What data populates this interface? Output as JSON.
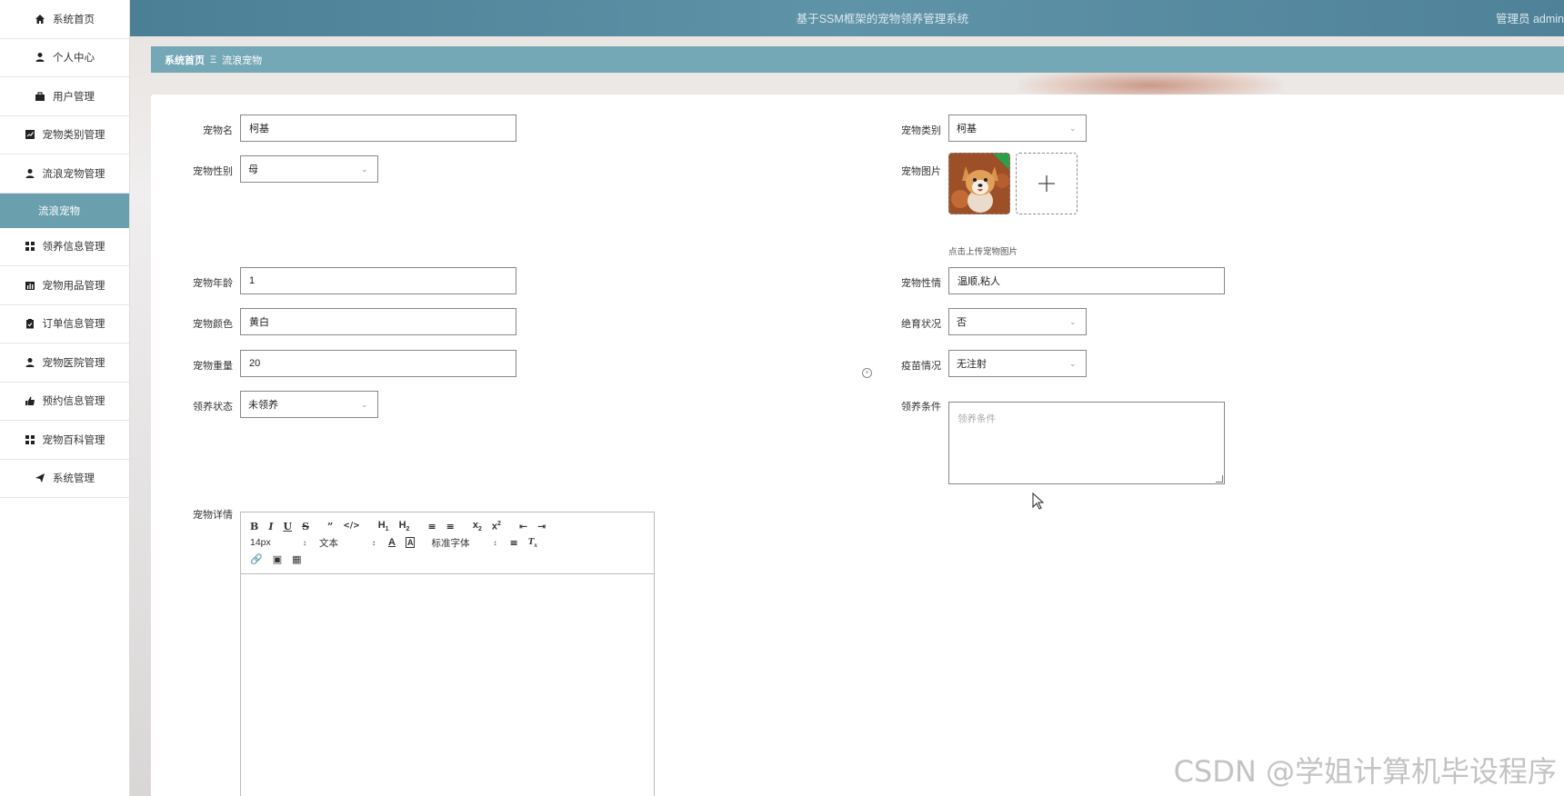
{
  "app": {
    "title": "基于SSM框架的宠物领养管理系统",
    "user": "管理员 admin"
  },
  "sidebar": {
    "items": [
      {
        "label": "系统首页",
        "icon": "home-icon"
      },
      {
        "label": "个人中心",
        "icon": "user-icon"
      },
      {
        "label": "用户管理",
        "icon": "briefcase-icon"
      },
      {
        "label": "宠物类别管理",
        "icon": "chart-icon"
      },
      {
        "label": "流浪宠物管理",
        "icon": "user-icon"
      },
      {
        "label": "流浪宠物",
        "icon": "",
        "active": true
      },
      {
        "label": "领养信息管理",
        "icon": "grid-icon"
      },
      {
        "label": "宠物用品管理",
        "icon": "bar-chart-icon"
      },
      {
        "label": "订单信息管理",
        "icon": "clipboard-icon"
      },
      {
        "label": "宠物医院管理",
        "icon": "user-icon"
      },
      {
        "label": "预约信息管理",
        "icon": "thumb-icon"
      },
      {
        "label": "宠物百科管理",
        "icon": "grid-icon"
      },
      {
        "label": "系统管理",
        "icon": "send-icon"
      }
    ],
    "active_color": "#6a9fae"
  },
  "breadcrumb": {
    "home": "系统首页",
    "separator": "Ξ",
    "current": "流浪宠物"
  },
  "form": {
    "pet_name": {
      "label": "宠物名",
      "value": "柯基"
    },
    "pet_category": {
      "label": "宠物类别",
      "value": "柯基"
    },
    "pet_gender": {
      "label": "宠物性别",
      "value": "母"
    },
    "pet_image": {
      "label": "宠物图片",
      "hint": "点击上传宠物图片"
    },
    "pet_age": {
      "label": "宠物年龄",
      "value": "1"
    },
    "pet_temper": {
      "label": "宠物性情",
      "value": "温顺,粘人"
    },
    "pet_color": {
      "label": "宠物颜色",
      "value": "黄白"
    },
    "sterilized": {
      "label": "绝育状况",
      "value": "否"
    },
    "pet_weight": {
      "label": "宠物重量",
      "value": "20"
    },
    "vaccine": {
      "label": "疫苗情况",
      "value": "无注射"
    },
    "adopt_status": {
      "label": "领养状态",
      "value": "未领养"
    },
    "adopt_condition": {
      "label": "领养条件",
      "placeholder": "领养条件"
    },
    "pet_detail": {
      "label": "宠物详情"
    }
  },
  "editor_toolbar": {
    "font_size": "14px",
    "text_type": "文本",
    "font_family": "标准字体"
  },
  "watermark": "CSDN @学姐计算机毕设程序"
}
